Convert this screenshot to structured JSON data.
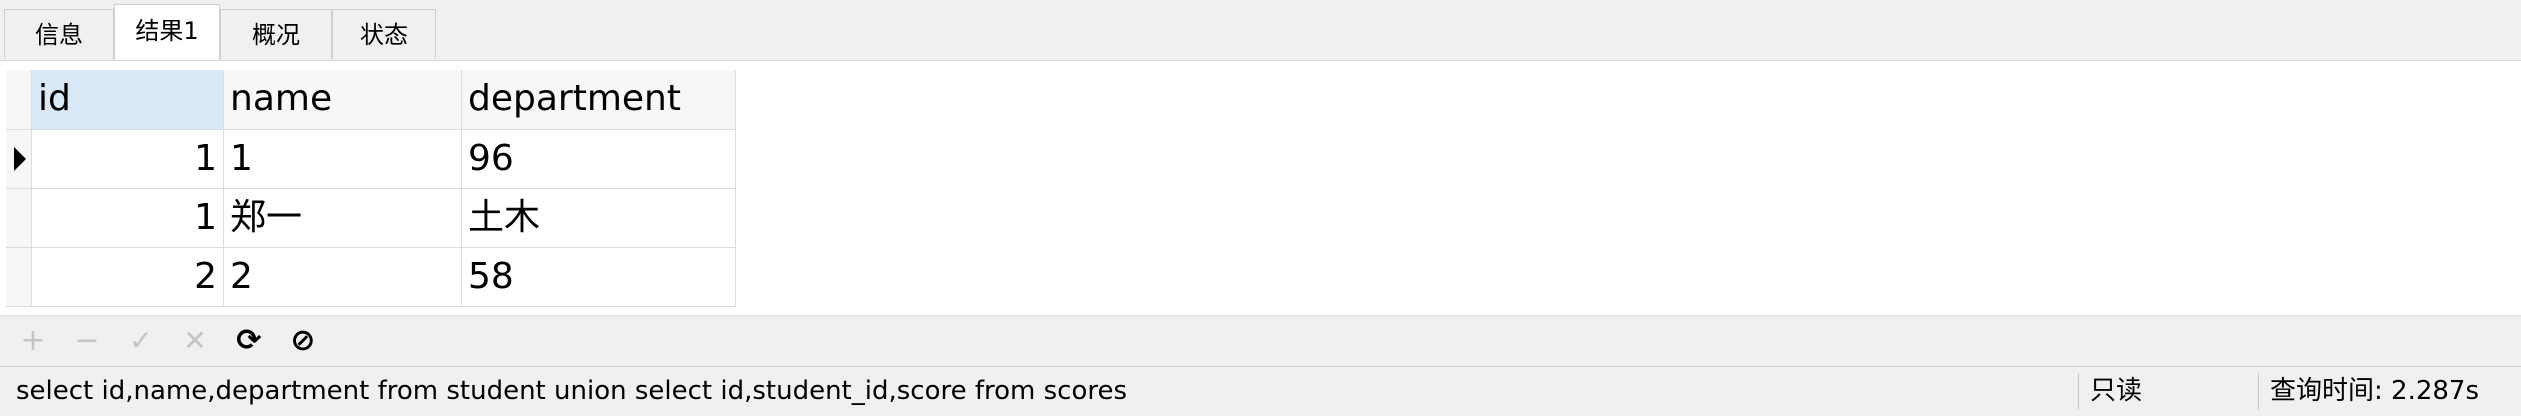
{
  "tabs": [
    {
      "label": "信息",
      "active": false
    },
    {
      "label": "结果1",
      "active": true
    },
    {
      "label": "概况",
      "active": false
    },
    {
      "label": "状态",
      "active": false
    }
  ],
  "grid": {
    "columns": [
      "id",
      "name",
      "department"
    ],
    "rows": [
      {
        "id": "1",
        "name": "1",
        "department": "96",
        "current": true
      },
      {
        "id": "1",
        "name": "郑一",
        "department": "土木",
        "current": false
      },
      {
        "id": "2",
        "name": "2",
        "department": "58",
        "current": false
      }
    ]
  },
  "toolbar": {
    "add": "+",
    "remove": "−",
    "apply": "✓",
    "cancel": "✕",
    "refresh": "⟳",
    "stop": "⊘"
  },
  "status": {
    "query": "select id,name,department from student union  select id,student_id,score from scores",
    "mode": "只读",
    "query_time": "查询时间: 2.287s"
  },
  "colors": {
    "selected_header": "#d8e8f6",
    "panel_bg": "#f0f0f0",
    "grid_line": "#dcdcdc"
  }
}
